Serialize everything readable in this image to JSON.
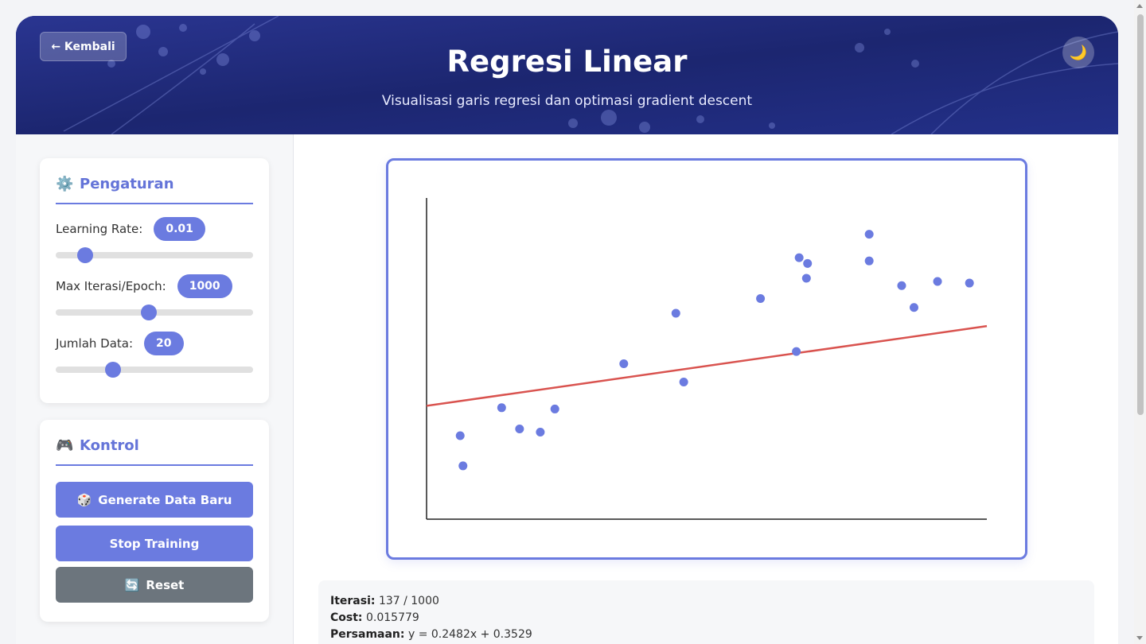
{
  "header": {
    "back_label": "← Kembali",
    "title": "Regresi Linear",
    "subtitle": "Visualisasi garis regresi dan optimasi gradient descent",
    "theme_icon": "🌙"
  },
  "settings": {
    "title": "Pengaturan",
    "icon": "⚙️",
    "learning_rate_label": "Learning Rate:",
    "learning_rate_value": "0.01",
    "learning_rate_fraction": 0.12,
    "max_iter_label": "Max Iterasi/Epoch:",
    "max_iter_value": "1000",
    "max_iter_fraction": 0.47,
    "data_count_label": "Jumlah Data:",
    "data_count_value": "20",
    "data_count_fraction": 0.27
  },
  "controls": {
    "title": "Kontrol",
    "icon": "🎮",
    "generate_icon": "🎲",
    "generate_label": "Generate Data Baru",
    "stop_label": "Stop Training",
    "reset_icon": "🔄",
    "reset_label": "Reset"
  },
  "stats": {
    "iter_label": "Iterasi:",
    "iter_value": "137 / 1000",
    "cost_label": "Cost:",
    "cost_value": "0.015779",
    "eq_label": "Persamaan:",
    "eq_value": "y = 0.2482x + 0.3529"
  },
  "colors": {
    "accent": "#6b7be0",
    "header_bg": "#1f2a7a",
    "regression_line": "#d9534f",
    "reset_button": "#6c757d"
  },
  "chart_data": {
    "type": "scatter",
    "xlim": [
      0,
      1
    ],
    "ylim": [
      0,
      1
    ],
    "points": [
      {
        "x": 0.06,
        "y": 0.26
      },
      {
        "x": 0.065,
        "y": 0.166
      },
      {
        "x": 0.134,
        "y": 0.347
      },
      {
        "x": 0.166,
        "y": 0.281
      },
      {
        "x": 0.203,
        "y": 0.271
      },
      {
        "x": 0.229,
        "y": 0.343
      },
      {
        "x": 0.352,
        "y": 0.484
      },
      {
        "x": 0.445,
        "y": 0.641
      },
      {
        "x": 0.459,
        "y": 0.427
      },
      {
        "x": 0.596,
        "y": 0.687
      },
      {
        "x": 0.66,
        "y": 0.522
      },
      {
        "x": 0.665,
        "y": 0.814
      },
      {
        "x": 0.678,
        "y": 0.75
      },
      {
        "x": 0.68,
        "y": 0.796
      },
      {
        "x": 0.79,
        "y": 0.887
      },
      {
        "x": 0.79,
        "y": 0.804
      },
      {
        "x": 0.848,
        "y": 0.727
      },
      {
        "x": 0.87,
        "y": 0.659
      },
      {
        "x": 0.912,
        "y": 0.74
      },
      {
        "x": 0.969,
        "y": 0.735
      }
    ],
    "line": {
      "slope": 0.2482,
      "intercept": 0.3529
    }
  }
}
